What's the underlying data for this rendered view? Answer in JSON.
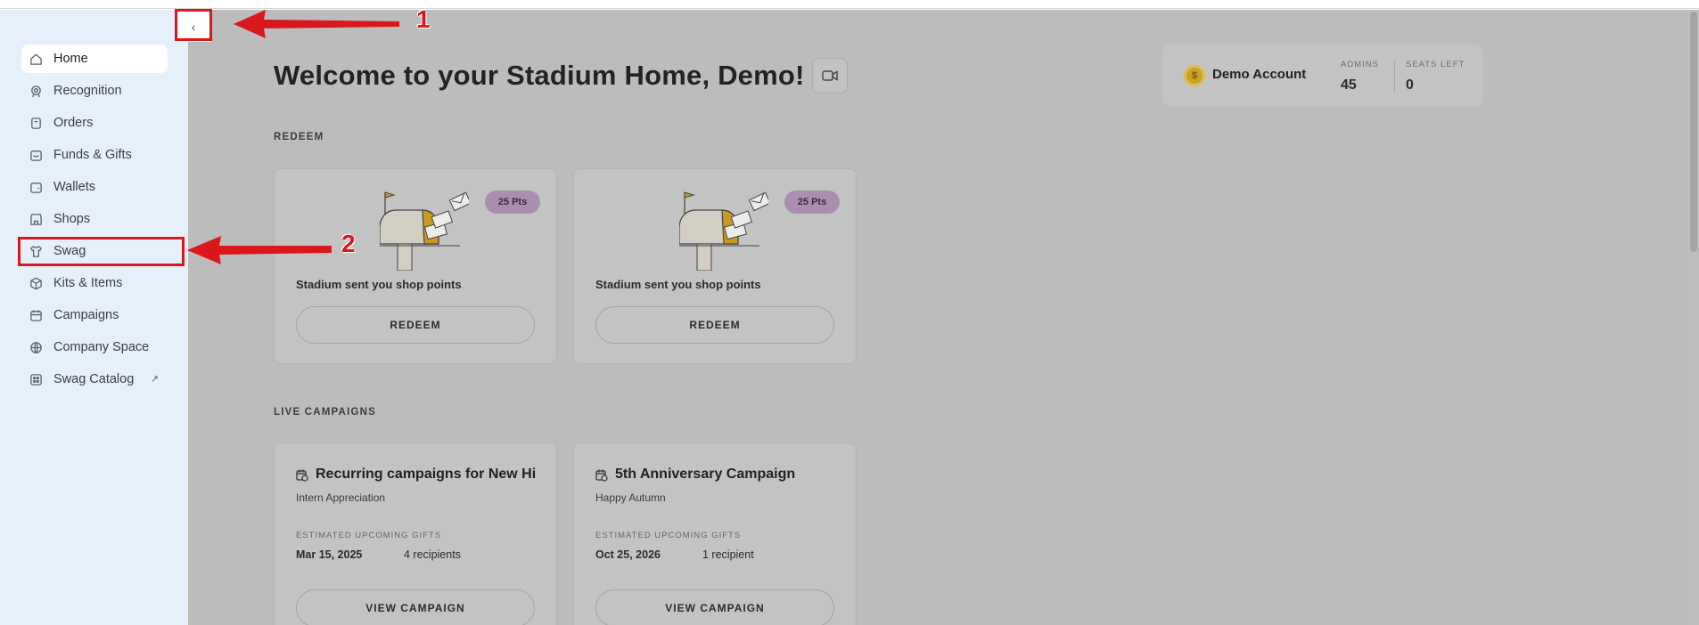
{
  "sidebar": {
    "items": [
      {
        "label": "Home",
        "icon": "home-icon"
      },
      {
        "label": "Recognition",
        "icon": "recognition-icon"
      },
      {
        "label": "Orders",
        "icon": "orders-icon"
      },
      {
        "label": "Funds & Gifts",
        "icon": "gift-icon"
      },
      {
        "label": "Wallets",
        "icon": "wallet-icon"
      },
      {
        "label": "Shops",
        "icon": "shop-icon"
      },
      {
        "label": "Swag",
        "icon": "shirt-icon"
      },
      {
        "label": "Kits & Items",
        "icon": "box-icon"
      },
      {
        "label": "Campaigns",
        "icon": "calendar-icon"
      },
      {
        "label": "Company Space",
        "icon": "globe-icon"
      },
      {
        "label": "Swag Catalog",
        "icon": "catalog-icon",
        "external": "↗"
      }
    ]
  },
  "collapse": {
    "glyph": "‹"
  },
  "header": {
    "welcome": "Welcome to your Stadium Home, Demo!"
  },
  "account": {
    "name": "Demo Account",
    "admins_label": "ADMINS",
    "admins_value": "45",
    "seats_label": "SEATS LEFT",
    "seats_value": "0"
  },
  "redeem": {
    "title": "REDEEM",
    "cards": [
      {
        "badge": "25 Pts",
        "text": "Stadium sent you shop points",
        "button": "REDEEM"
      },
      {
        "badge": "25 Pts",
        "text": "Stadium sent you shop points",
        "button": "REDEEM"
      }
    ]
  },
  "campaigns": {
    "title": "LIVE CAMPAIGNS",
    "cards": [
      {
        "title": "Recurring campaigns for New Hi",
        "subtitle": "Intern Appreciation",
        "label": "ESTIMATED UPCOMING GIFTS",
        "date": "Mar 15, 2025",
        "recipients": "4 recipients",
        "button": "VIEW CAMPAIGN"
      },
      {
        "title": "5th Anniversary Campaign",
        "subtitle": "Happy Autumn",
        "label": "ESTIMATED UPCOMING GIFTS",
        "date": "Oct 25, 2026",
        "recipients": "1 recipient",
        "button": "VIEW CAMPAIGN"
      }
    ]
  },
  "annotations": {
    "one": "1",
    "two": "2",
    "color": "#d9171d"
  },
  "colors": {
    "sidebar_bg": "#e6f0fb",
    "badge": "#a98eb0",
    "overlay": "#bcbcbc"
  }
}
